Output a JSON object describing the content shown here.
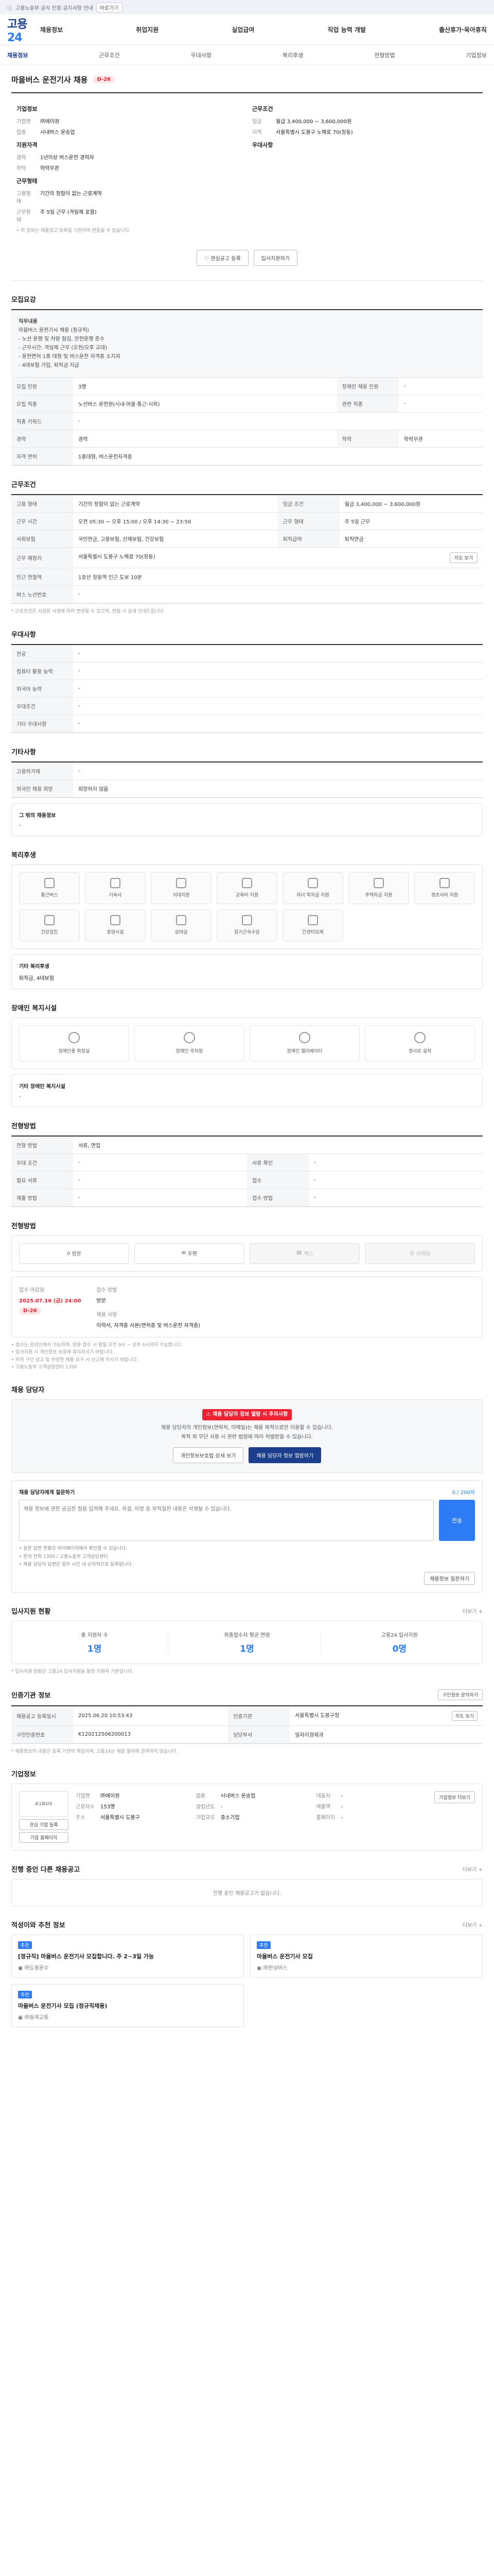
{
  "topbar": {
    "notice": "고용노동부 공식 인증 공지사항 안내",
    "pill": "바로가기"
  },
  "header": {
    "logo_a": "고용",
    "logo_b": "24",
    "nav": [
      "채용정보",
      "취업지원",
      "실업급여",
      "직업 능력 개발",
      "출산휴가·육아휴직"
    ]
  },
  "subnav": {
    "home": "채용정보",
    "items": [
      "근무조건",
      "우대사항",
      "복리후생",
      "전형방법",
      "기업정보"
    ]
  },
  "job": {
    "title": "마을버스 운전기사 채용",
    "dday": "D-26",
    "company_label": "기업정보",
    "company": [
      {
        "k": "기업명",
        "v": "㈜에이원"
      },
      {
        "k": "업종",
        "v": "시내버스 운송업"
      }
    ],
    "cond_label": "근무조건",
    "cond": [
      {
        "k": "임금",
        "v": "월급 3,400,000 ~ 3,600,000원"
      },
      {
        "k": "지역",
        "v": "서울특별시 도봉구 노해로 70(창동)"
      }
    ],
    "req_label": "지원자격",
    "req": [
      {
        "k": "경력",
        "v": "1년이상 버스운전 경력자"
      },
      {
        "k": "학력",
        "v": "학력무관"
      }
    ],
    "pref_label": "우대사항",
    "work_label": "근무형태",
    "work": [
      {
        "k": "고용형태",
        "v": "기간의 정함이 없는 근로계약"
      },
      {
        "k": "근무형태",
        "v": "주 5일 근무 (격일제 포함)"
      }
    ],
    "hint": "• 위 정보는 채용공고 등록일 기준이며 변동될 수 있습니다."
  },
  "actions": {
    "scrap": "관심공고 등록",
    "apply": "입사지원하기"
  },
  "recruit": {
    "title": "모집요강",
    "desc": [
      "직무내용",
      "마을버스 운전기사 채용 (정규직)",
      "- 노선 운행 및 차량 점검, 안전운행 준수",
      "- 근무시간: 격일제 근무 (오전/오후 교대)",
      "- 운전면허 1종 대형 및 버스운전 자격증 소지자",
      "- 4대보험 가입, 퇴직금 지급"
    ],
    "rows": [
      {
        "k": "모집 인원",
        "v": "3명",
        "k2": "장애인 채용 인원",
        "v2": "-"
      },
      {
        "k": "모집 직종",
        "v": "노선버스 운전원(시내·마을·통근·시외)",
        "k2": "관련 직종",
        "v2": "-"
      },
      {
        "k": "직종 키워드",
        "v": "-",
        "k2": "",
        "v2": ""
      },
      {
        "k": "경력",
        "v": "경력",
        "k2": "학력",
        "v2": "학력무관"
      },
      {
        "k": "자격 면허",
        "v": "1종대형, 버스운전자격증",
        "k2": "",
        "v2": ""
      }
    ]
  },
  "workcond": {
    "title": "근무조건",
    "rows": [
      {
        "k": "고용 형태",
        "v": "기간의 정함이 없는 근로계약",
        "k2": "임금 조건",
        "v2": "월급 3,400,000 ~ 3,600,000원"
      },
      {
        "k": "근무 시간",
        "v": "오전 05:30 ~ 오후 15:00 / 오후 14:30 ~ 23:50",
        "k2": "근무 형태",
        "v2": "주 5일 근무"
      },
      {
        "k": "사회보험",
        "v": "국민연금, 고용보험, 산재보험, 건강보험",
        "k2": "퇴직급여",
        "v2": "퇴직연금"
      },
      {
        "k": "근무 예정지",
        "v": "서울특별시 도봉구 노해로 70(창동)",
        "k2": "",
        "v2": ""
      },
      {
        "k": "인근 전철역",
        "v": "1호선 창동역 인근 도보 10분",
        "k2": "",
        "v2": ""
      },
      {
        "k": "버스 노선번호",
        "v": "-",
        "k2": "",
        "v2": ""
      }
    ],
    "map_btn": "지도 보기",
    "note": "* 근로조건은 사업장 사정에 따라 변경될 수 있으며, 면접 시 상세 안내드립니다."
  },
  "pref": {
    "title": "우대사항",
    "rows": [
      {
        "k": "전공",
        "v": "-"
      },
      {
        "k": "컴퓨터 활용 능력",
        "v": "-"
      },
      {
        "k": "외국어 능력",
        "v": "-"
      },
      {
        "k": "우대조건",
        "v": "-"
      },
      {
        "k": "기타 우대사항",
        "v": "-"
      }
    ]
  },
  "etc": {
    "title": "기타사항",
    "rows": [
      {
        "k": "고용허가제",
        "v": "-"
      },
      {
        "k": "외국인 채용 희망",
        "v": "희망하지 않음"
      }
    ],
    "extra_title": "그 밖의 채용정보",
    "extra": "-"
  },
  "welfare": {
    "title": "복리후생",
    "items": [
      "통근버스",
      "기숙사",
      "식대지원",
      "교육비 지원",
      "자녀 학자금 지원",
      "주택자금 지원",
      "경조사비 지원",
      "건강검진",
      "휴양시설",
      "상여금",
      "장기근속수당",
      "인센티브제"
    ],
    "extra_title": "기타 복리후생",
    "extra": "퇴직금, 4대보험"
  },
  "disability": {
    "title": "장애인 복지시설",
    "items": [
      "장애인용 화장실",
      "장애인 주차장",
      "장애인 엘리베이터",
      "경사로 설치"
    ],
    "extra_title": "기타 장애인 복지시설",
    "extra": "-"
  },
  "process": {
    "title": "전형방법",
    "rows": [
      {
        "k": "전형 방법",
        "v": "서류, 면접"
      },
      {
        "k": "우대 조건",
        "v": "-",
        "k2": "서류 확인",
        "v2": "-"
      },
      {
        "k": "필요 서류",
        "v": "-",
        "k2": "접수",
        "v2": "-"
      },
      {
        "k": "제출 방법",
        "v": "-",
        "k2": "접수 방법",
        "v2": "-"
      }
    ]
  },
  "apply": {
    "title": "전형방법",
    "methods": [
      {
        "label": "방문",
        "off": false
      },
      {
        "label": "우편",
        "off": false
      },
      {
        "label": "팩스",
        "off": true
      },
      {
        "label": "이메일",
        "off": true
      }
    ],
    "period_label": "접수 마감일",
    "period": "2025.07.16 (금) 24:00",
    "dday": "D-26",
    "count_label": "접수 방법",
    "count": "방문",
    "contact_label": "채용 사항",
    "contact": "이력서, 자격증 사본(면허증 및 버스운전 자격증)",
    "notes": [
      "• 접수는 온라인에서 가능하며, 방문 접수 시 평일 오전 9시 ~ 오후 6시까지 가능합니다.",
      "• 입사지원 시 개인정보 보호에 유의하시기 바랍니다.",
      "• 허위 구인 광고 및 부당한 채용 요구 시 신고해 주시기 바랍니다.",
      "• 고용노동부 고객상담센터 1350"
    ]
  },
  "qa": {
    "title": "채용 담당자",
    "warn": "채용 담당자 정보 열람 시 주의사항",
    "body1": "채용 담당자의 개인정보(연락처, 이메일)는 채용 목적으로만 이용할 수 있습니다.",
    "body2": "목적 외 무단 사용 시 관련 법령에 따라 처벌받을 수 있습니다.",
    "btn1": "개인정보보호법 상세 보기",
    "btn2": "채용 담당자 정보 열람하기",
    "form_title": "채용 담당자에게 질문하기",
    "form_count": "0 / 200자",
    "placeholder": "채용 정보에 관한 궁금한 점을 입력해 주세요. 욕설, 비방 등 부적절한 내용은 삭제될 수 있습니다.",
    "send": "전송",
    "notes": [
      "• 질문 답변 현황은 마이페이지에서 확인할 수 있습니다.",
      "• 문의 전화 1350 / 고용노동부 고객상담센터",
      "• 채용 담당자 답변은 업무 시간 내 순차적으로 등록됩니다."
    ],
    "more_btn": "채용정보 질문하기"
  },
  "stats": {
    "title": "입사지원 현황",
    "more": "더보기 +",
    "items": [
      {
        "label": "총 지원자 수",
        "value": "1명"
      },
      {
        "label": "최종접수자 평균 연령",
        "value": "1명"
      },
      {
        "label": "고용24 입사지원",
        "value": "0명"
      }
    ],
    "note": "* 입사지원 현황은 고용24 입사지원을 통한 지원자 기준입니다."
  },
  "register": {
    "title": "인증기관 정보",
    "more": "구인정보 문의하기",
    "rows": [
      {
        "k": "채용공고 등록일시",
        "v": "2025.06.20 10:53:43",
        "k2": "인증기관",
        "v2": "서울특별시 도봉구청"
      },
      {
        "k": "구인인증번호",
        "v": "K120212506200013",
        "k2": "담당부서",
        "v2": "일자리경제과"
      }
    ],
    "dept_btn": "지도 보기",
    "note": "* 채용정보의 내용은 등록 기관의 책임이며, 고용24는 채용 절차에 관여하지 않습니다."
  },
  "company": {
    "title": "기업정보",
    "logo": "A1BUS",
    "btn1": "관심 기업 등록",
    "btn2": "기업 홈페이지",
    "info": [
      {
        "k": "기업명",
        "v": "㈜에이원"
      },
      {
        "k": "업종",
        "v": "시내버스 운송업"
      },
      {
        "k": "대표자",
        "v": "-"
      },
      {
        "k": "근로자수",
        "v": "153명"
      },
      {
        "k": "설립년도",
        "v": "-"
      },
      {
        "k": "매출액",
        "v": "-"
      },
      {
        "k": "주소",
        "v": "서울특별시 도봉구"
      },
      {
        "k": "기업규모",
        "v": "중소기업"
      },
      {
        "k": "홈페이지",
        "v": "-"
      }
    ],
    "more_btn": "기업정보 더보기"
  },
  "others": {
    "title": "진행 중인 다른 채용공고",
    "more": "더보기 +",
    "empty": "진행 중인 채용공고가 없습니다."
  },
  "recs": {
    "title": "적성이와 추천 정보",
    "more": "더보기 +",
    "items": [
      {
        "tag": "추천",
        "title": "[정규직] 마을버스 운전기사 모집합니다. 주 2~3일 가능",
        "company": "㈜도봉운수"
      },
      {
        "tag": "추천",
        "title": "마을버스 운전기사 모집",
        "company": "㈜한성버스"
      },
      {
        "tag": "추천",
        "title": "마을버스 운전기사 모집 (정규직채용)",
        "company": "㈜동북교통"
      }
    ]
  }
}
